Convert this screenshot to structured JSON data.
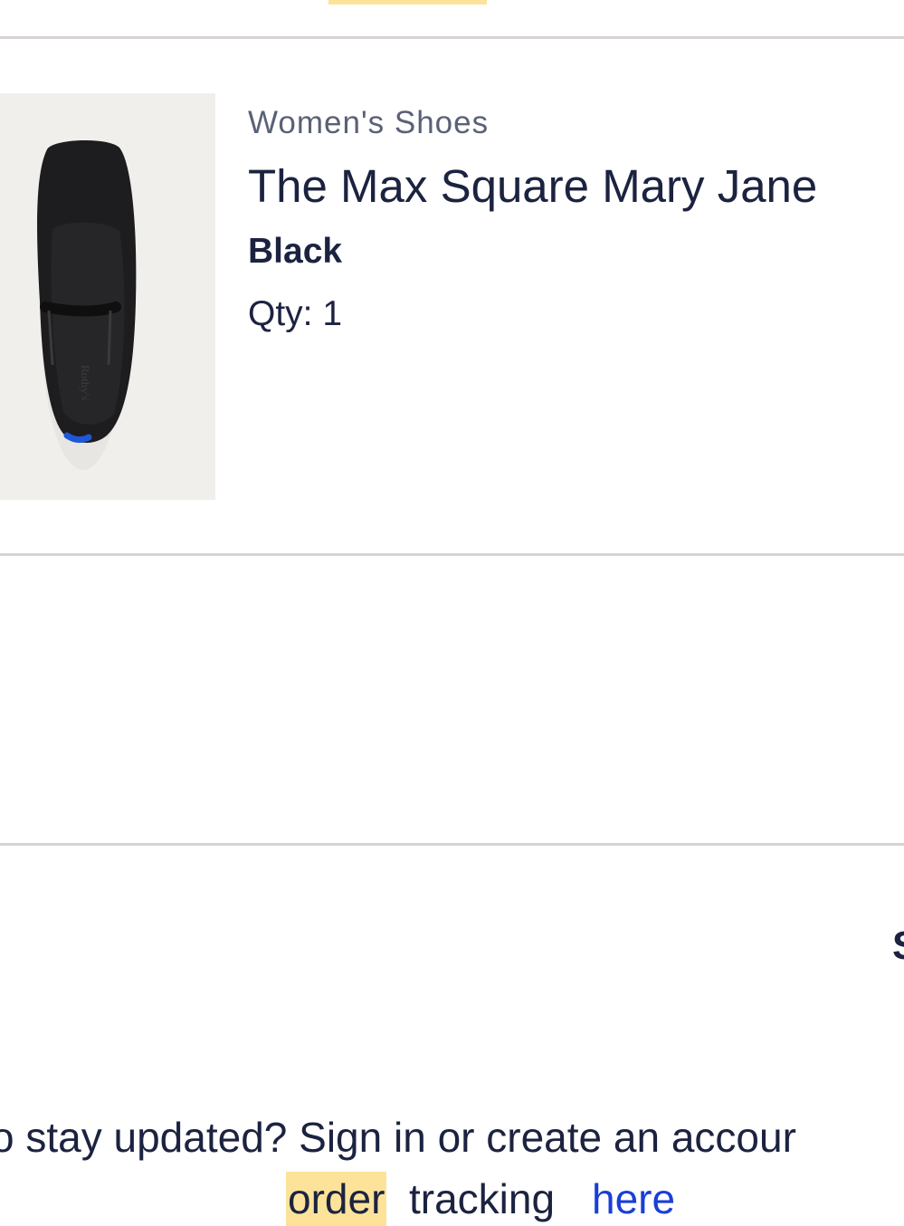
{
  "product": {
    "category": "Women's Shoes",
    "name": "The Max Square Mary Jane",
    "color": "Black",
    "qty": "Qty: 1",
    "insole_text": "Rothy's"
  },
  "section_edge_text": "S",
  "signin_prompt": "o stay updated? Sign in or create an accour",
  "tracking": {
    "highlight_word": "order",
    "middle_text": "tracking",
    "link_text": "here"
  },
  "colors": {
    "text_primary": "#1c2340",
    "text_secondary": "#5a6177",
    "link": "#1a3fd6",
    "highlight": "#fde39a",
    "divider": "#d8d3d1",
    "image_bg": "#f1efec"
  }
}
